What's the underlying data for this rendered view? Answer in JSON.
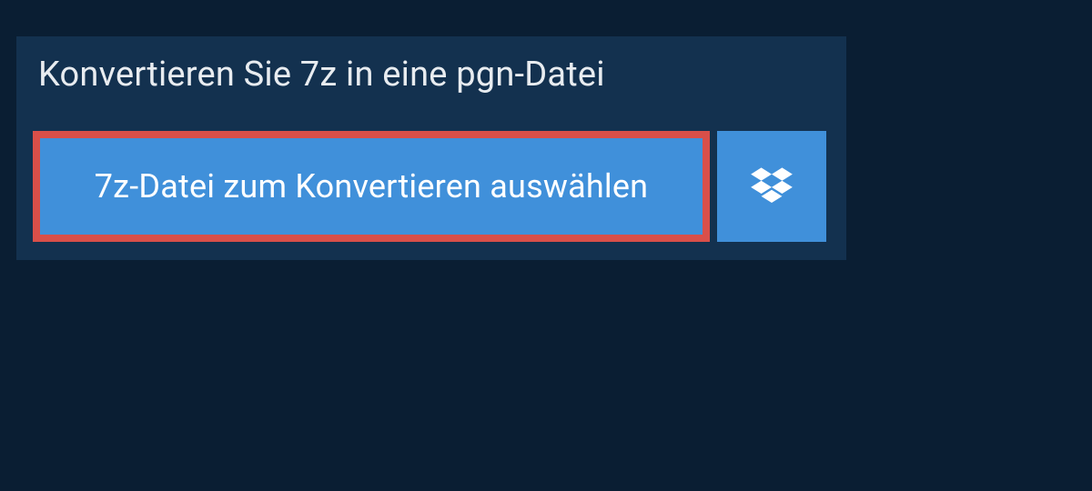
{
  "header": {
    "title": "Konvertieren Sie 7z in eine pgn-Datei"
  },
  "actions": {
    "select_file_label": "7z-Datei zum Konvertieren auswählen",
    "dropbox_icon": "dropbox-icon"
  },
  "colors": {
    "page_bg": "#0a1e33",
    "panel_bg": "#13314f",
    "button_bg": "#4090da",
    "highlight_border": "#d94f49",
    "text_light": "#ffffff"
  }
}
